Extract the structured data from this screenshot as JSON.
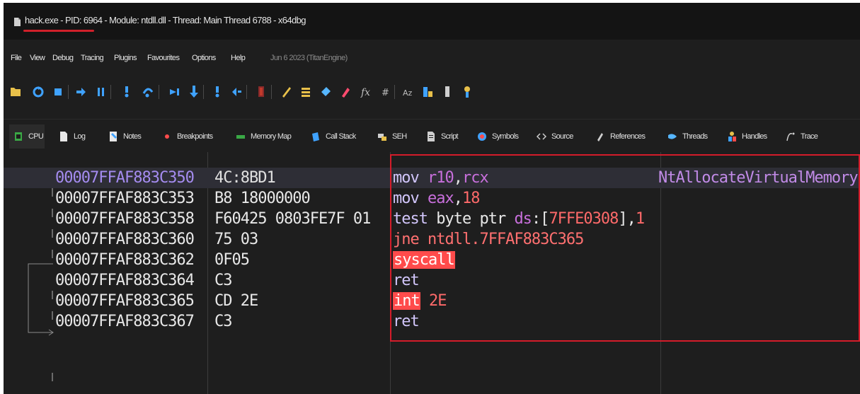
{
  "window": {
    "title": "hack.exe - PID: 6964 - Module: ntdll.dll - Thread: Main Thread 6788 - x64dbg"
  },
  "menu": {
    "items": [
      "File",
      "View",
      "Debug",
      "Tracing",
      "Plugins",
      "Favourites",
      "Options",
      "Help"
    ],
    "build_date": "Jun 6 2023 (TitanEngine)"
  },
  "toolbar": {
    "icons": [
      "open-icon",
      "restart-icon",
      "stop-icon",
      "run-icon",
      "pause-icon",
      "step-into-icon",
      "step-over-icon",
      "execute-till-return-icon",
      "run-to-user-code-icon",
      "animate-into-icon",
      "animate-over-icon",
      "trace-icon",
      "patch-icon",
      "comment-icon",
      "label-icon",
      "bookmark-icon",
      "function-icon",
      "argument-icon",
      "strings-icon",
      "calls-icon",
      "memory-icon",
      "info-icon"
    ]
  },
  "tabs": [
    {
      "label": "CPU",
      "icon": "cpu-icon",
      "active": true
    },
    {
      "label": "Log",
      "icon": "log-icon"
    },
    {
      "label": "Notes",
      "icon": "notes-icon"
    },
    {
      "label": "Breakpoints",
      "icon": "breakpoints-icon"
    },
    {
      "label": "Memory Map",
      "icon": "memory-map-icon"
    },
    {
      "label": "Call Stack",
      "icon": "call-stack-icon"
    },
    {
      "label": "SEH",
      "icon": "seh-icon"
    },
    {
      "label": "Script",
      "icon": "script-icon"
    },
    {
      "label": "Symbols",
      "icon": "symbols-icon"
    },
    {
      "label": "Source",
      "icon": "source-icon"
    },
    {
      "label": "References",
      "icon": "references-icon"
    },
    {
      "label": "Threads",
      "icon": "threads-icon"
    },
    {
      "label": "Handles",
      "icon": "handles-icon"
    },
    {
      "label": "Trace",
      "icon": "trace-icon"
    }
  ],
  "disasm": {
    "rows": [
      {
        "address": "00007FFAF883C350",
        "bytes": "4C:8BD1",
        "instr": [
          "mov",
          " ",
          "r10",
          ",",
          "rcx"
        ],
        "comment": "NtAllocateVirtualMemory"
      },
      {
        "address": "00007FFAF883C353",
        "bytes": "B8 18000000",
        "instr": [
          "mov",
          " ",
          "eax",
          ",",
          "18"
        ],
        "comment": ""
      },
      {
        "address": "00007FFAF883C358",
        "bytes": "F60425 0803FE7F 01",
        "instr": [
          "test",
          " byte ptr ",
          "ds",
          ":[",
          "7FFE0308",
          "],",
          "1"
        ],
        "comment": ""
      },
      {
        "address": "00007FFAF883C360",
        "bytes": "75 03",
        "instr": [
          "jne ntdll.7FFAF883C365"
        ],
        "comment": ""
      },
      {
        "address": "00007FFAF883C362",
        "bytes": "0F05",
        "instr": [
          "syscall"
        ],
        "comment": ""
      },
      {
        "address": "00007FFAF883C364",
        "bytes": "C3",
        "instr": [
          "ret"
        ],
        "comment": ""
      },
      {
        "address": "00007FFAF883C365",
        "bytes": "CD 2E",
        "instr": [
          "int",
          " 2E"
        ],
        "comment": ""
      },
      {
        "address": "00007FFAF883C367",
        "bytes": "C3",
        "instr": [
          "ret"
        ],
        "comment": ""
      }
    ]
  },
  "colors": {
    "highlight_box": "#d41c2a",
    "syscall_bg": "#ff4b4b",
    "register": "#c86fdc",
    "immediate": "#ff6a6a"
  }
}
